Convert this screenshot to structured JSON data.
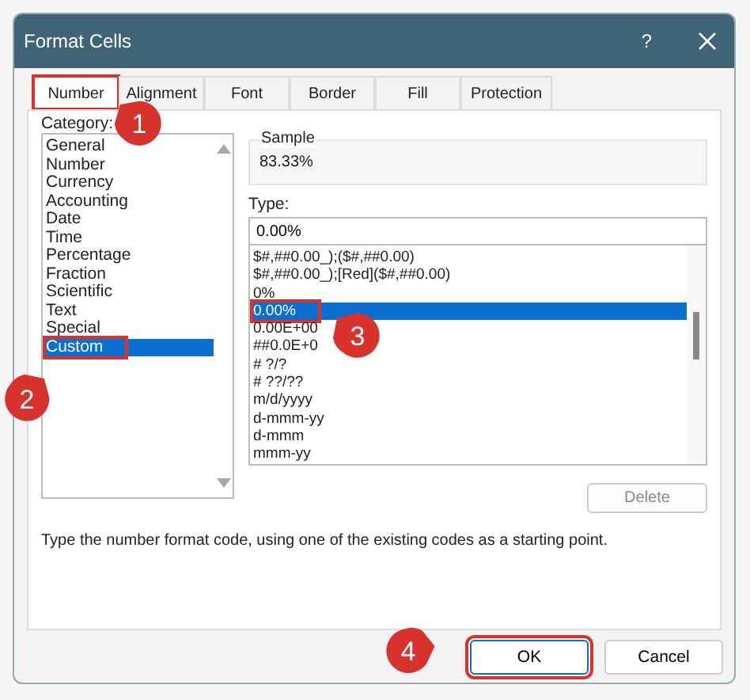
{
  "window": {
    "title": "Format Cells",
    "help": "?"
  },
  "tabs": [
    {
      "label": "Number",
      "selected": true,
      "highlighted": true
    },
    {
      "label": "Alignment",
      "selected": false,
      "highlighted": false
    },
    {
      "label": "Font",
      "selected": false,
      "highlighted": false
    },
    {
      "label": "Border",
      "selected": false,
      "highlighted": false
    },
    {
      "label": "Fill",
      "selected": false,
      "highlighted": false
    },
    {
      "label": "Protection",
      "selected": false,
      "highlighted": false
    }
  ],
  "category": {
    "label": "Category:",
    "items": [
      {
        "label": "General",
        "selected": false,
        "highlighted": false
      },
      {
        "label": "Number",
        "selected": false,
        "highlighted": false
      },
      {
        "label": "Currency",
        "selected": false,
        "highlighted": false
      },
      {
        "label": "Accounting",
        "selected": false,
        "highlighted": false
      },
      {
        "label": "Date",
        "selected": false,
        "highlighted": false
      },
      {
        "label": "Time",
        "selected": false,
        "highlighted": false
      },
      {
        "label": "Percentage",
        "selected": false,
        "highlighted": false
      },
      {
        "label": "Fraction",
        "selected": false,
        "highlighted": false
      },
      {
        "label": "Scientific",
        "selected": false,
        "highlighted": false
      },
      {
        "label": "Text",
        "selected": false,
        "highlighted": false
      },
      {
        "label": "Special",
        "selected": false,
        "highlighted": false
      },
      {
        "label": "Custom",
        "selected": true,
        "highlighted": true
      }
    ]
  },
  "sample": {
    "label": "Sample",
    "value": "83.33%"
  },
  "type": {
    "label": "Type:",
    "value": "0.00%",
    "items": [
      {
        "label": "$#,##0.00_);($#,##0.00)",
        "selected": false,
        "highlighted": false
      },
      {
        "label": "$#,##0.00_);[Red]($#,##0.00)",
        "selected": false,
        "highlighted": false
      },
      {
        "label": "0%",
        "selected": false,
        "highlighted": false
      },
      {
        "label": "0.00%",
        "selected": true,
        "highlighted": true
      },
      {
        "label": "0.00E+00",
        "selected": false,
        "highlighted": false
      },
      {
        "label": "##0.0E+0",
        "selected": false,
        "highlighted": false
      },
      {
        "label": "# ?/?",
        "selected": false,
        "highlighted": false
      },
      {
        "label": "# ??/??",
        "selected": false,
        "highlighted": false
      },
      {
        "label": "m/d/yyyy",
        "selected": false,
        "highlighted": false
      },
      {
        "label": "d-mmm-yy",
        "selected": false,
        "highlighted": false
      },
      {
        "label": "d-mmm",
        "selected": false,
        "highlighted": false
      },
      {
        "label": "mmm-yy",
        "selected": false,
        "highlighted": false
      }
    ]
  },
  "delete_button": {
    "label": "Delete",
    "disabled": true
  },
  "description": "Type the number format code, using one of the existing codes as a starting point.",
  "buttons": [
    {
      "label": "OK",
      "highlighted": true
    },
    {
      "label": "Cancel",
      "highlighted": false
    }
  ],
  "callouts": [
    {
      "label": "1"
    },
    {
      "label": "2"
    },
    {
      "label": "3"
    },
    {
      "label": "4"
    }
  ]
}
